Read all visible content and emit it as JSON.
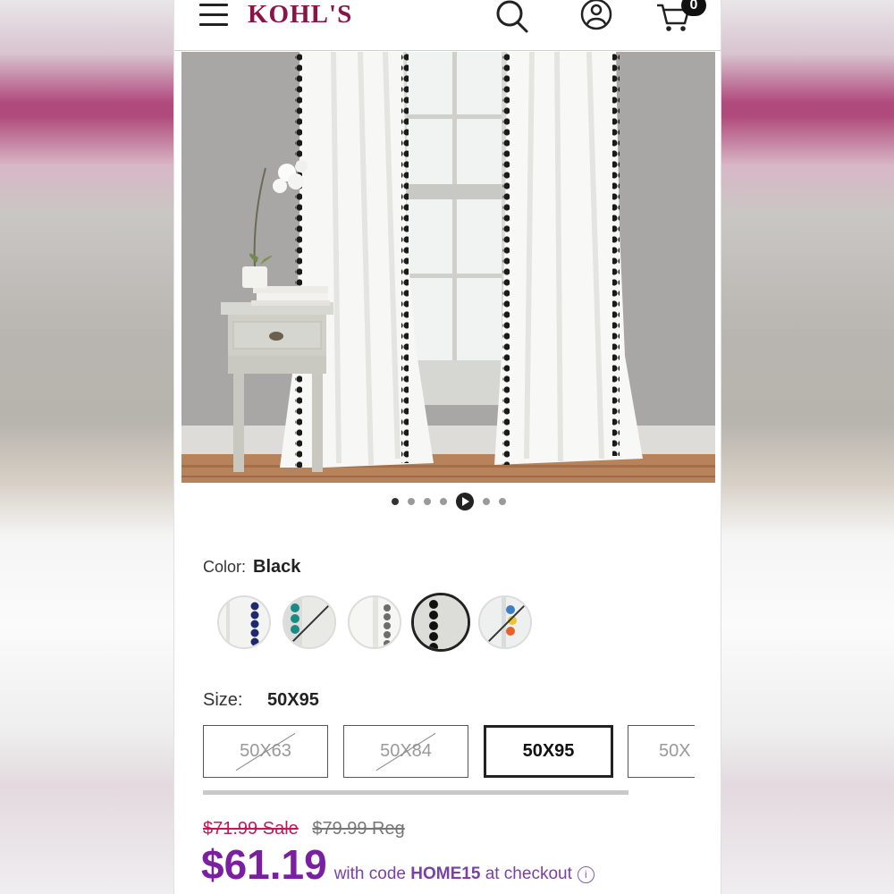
{
  "header": {
    "logo_text": "KOHL'S",
    "cart_count": "0"
  },
  "carousel": {
    "dot_count": 7,
    "active_index": 4
  },
  "color": {
    "label": "Color:",
    "selected": "Black",
    "swatches": [
      {
        "name": "navy",
        "available": true
      },
      {
        "name": "teal",
        "available": false
      },
      {
        "name": "gray",
        "available": true
      },
      {
        "name": "black",
        "available": true,
        "selected": true
      },
      {
        "name": "multi",
        "available": false
      }
    ]
  },
  "size": {
    "label": "Size:",
    "selected": "50X95",
    "options": [
      {
        "label": "50X63",
        "available": false
      },
      {
        "label": "50X84",
        "available": false
      },
      {
        "label": "50X95",
        "available": true,
        "selected": true
      },
      {
        "label": "50X",
        "available": true
      }
    ]
  },
  "price": {
    "sale_old": "$71.99 Sale",
    "reg_old": "$79.99 Reg",
    "final": "$61.19",
    "promo_prefix": "with code",
    "promo_code": "HOME15",
    "promo_suffix": "at checkout"
  },
  "colors": {
    "brand": "#8a1347",
    "promo_purple": "#7b1fa2",
    "sale_red": "#c2185b"
  }
}
